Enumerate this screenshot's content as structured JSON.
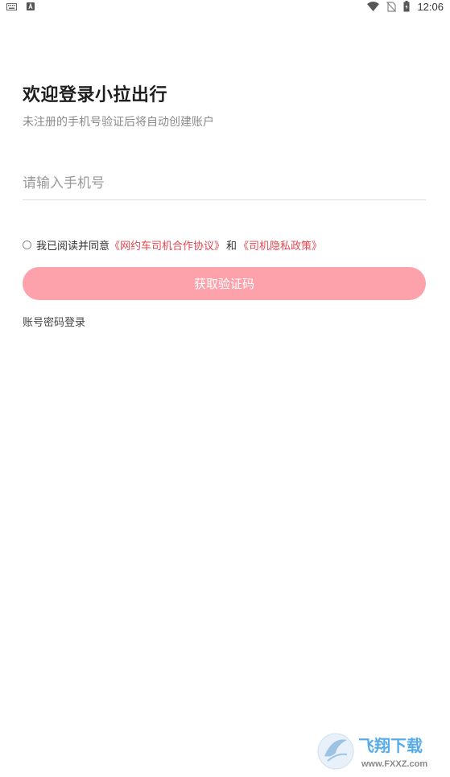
{
  "status_bar": {
    "time": "12:06",
    "left_icons": [
      "keyboard-icon",
      "a-notification-icon"
    ],
    "right_icons": [
      "wifi-icon",
      "no-sim-icon",
      "battery-icon"
    ]
  },
  "header": {
    "title": "欢迎登录小拉出行",
    "subtitle": "未注册的手机号验证后将自动创建账户"
  },
  "phone_field": {
    "value": "",
    "placeholder": "请输入手机号"
  },
  "agreement": {
    "checked": false,
    "prefix": "我已阅读并同意",
    "link1": "《网约车司机合作协议》",
    "connector": "和",
    "link2": "《司机隐私政策》"
  },
  "button": {
    "label": "获取验证码"
  },
  "password_login": "账号密码登录",
  "watermark": {
    "text": "飞翔下载",
    "url_text": "www.FXXZ.com"
  },
  "colors": {
    "accent": "#fda2ab",
    "link": "#e4464f",
    "watermark_blue": "#1f8fe0"
  }
}
